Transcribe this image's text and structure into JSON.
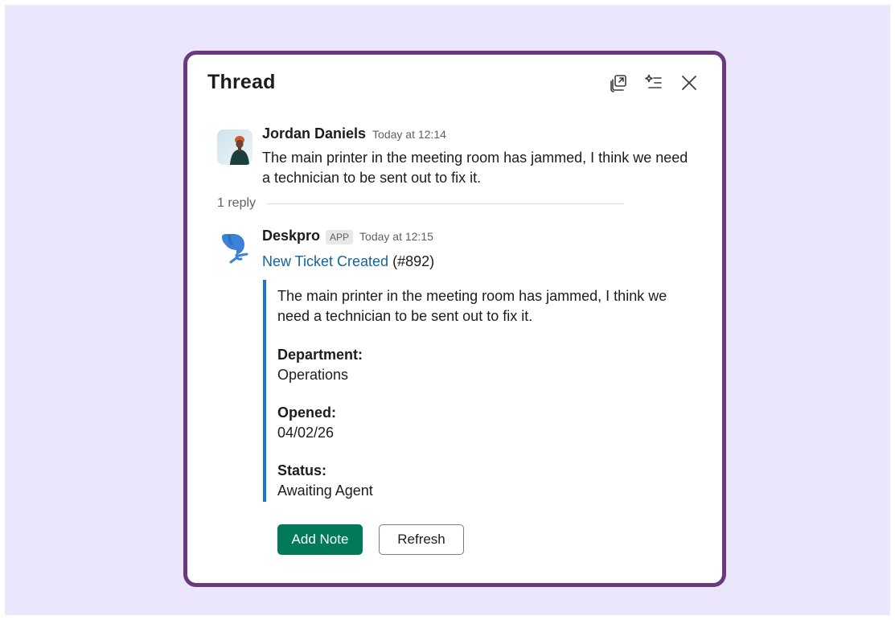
{
  "thread": {
    "title": "Thread",
    "header_icons": [
      "open-in-window-icon",
      "ai-summary-icon",
      "close-icon"
    ]
  },
  "original_message": {
    "author": "Jordan Daniels",
    "time": "Today at 12:14",
    "text": "The main printer in the meeting room has jammed, I think we need a technician to be sent out to fix it."
  },
  "replies": {
    "count_label": "1 reply"
  },
  "bot_message": {
    "author": "Deskpro",
    "badge": "APP",
    "time": "Today at 12:15",
    "link_text": "New Ticket Created",
    "ticket_ref": "(#892)",
    "attachment": {
      "text": "The main printer in the meeting room has jammed, I think we need a technician to be sent out to fix it.",
      "fields": [
        {
          "label": "Department:",
          "value": "Operations"
        },
        {
          "label": "Opened:",
          "value": "04/02/26"
        },
        {
          "label": "Status:",
          "value": "Awaiting Agent"
        }
      ]
    },
    "actions": {
      "primary_label": "Add Note",
      "secondary_label": "Refresh"
    }
  },
  "colors": {
    "page_background": "#ece6fc",
    "panel_border": "#6a3a7c",
    "link": "#1264a3",
    "attachment_bar": "#1d75c6",
    "primary_button": "#007a5a",
    "deskpro_blue": "#3b82d6"
  }
}
